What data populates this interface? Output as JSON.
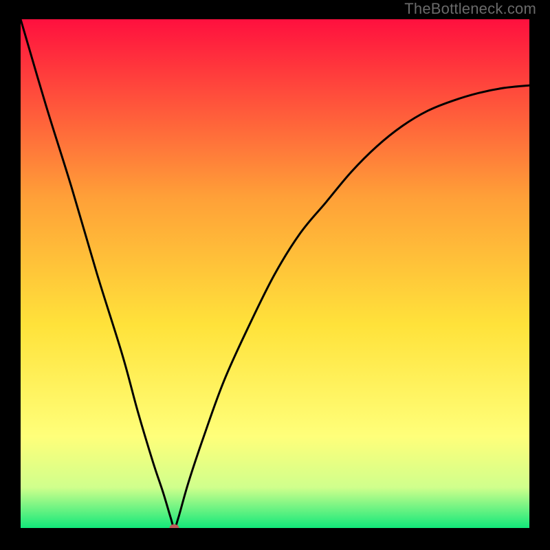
{
  "watermark": "TheBottleneck.com",
  "colors": {
    "frame": "#000000",
    "gradient_top": "#ff103e",
    "gradient_mid_upper": "#ffa038",
    "gradient_mid": "#ffe23a",
    "gradient_low": "#ffff7a",
    "gradient_near_bottom": "#d0ff8c",
    "gradient_bottom": "#12e87a",
    "curve": "#000000",
    "marker": "#bf5b5b"
  },
  "chart_data": {
    "type": "line",
    "title": "",
    "xlabel": "",
    "ylabel": "",
    "xlim": [
      0,
      1
    ],
    "ylim": [
      0,
      1
    ],
    "marker": {
      "x": 0.302,
      "y": 0.0
    },
    "series": [
      {
        "name": "curve",
        "x": [
          0.0,
          0.05,
          0.1,
          0.15,
          0.2,
          0.23,
          0.26,
          0.28,
          0.295,
          0.302,
          0.31,
          0.33,
          0.36,
          0.4,
          0.45,
          0.5,
          0.55,
          0.6,
          0.65,
          0.7,
          0.75,
          0.8,
          0.85,
          0.9,
          0.95,
          1.0
        ],
        "y": [
          1.0,
          0.83,
          0.67,
          0.5,
          0.34,
          0.23,
          0.13,
          0.07,
          0.02,
          0.0,
          0.02,
          0.09,
          0.18,
          0.29,
          0.4,
          0.5,
          0.58,
          0.64,
          0.7,
          0.75,
          0.79,
          0.82,
          0.84,
          0.855,
          0.865,
          0.87
        ]
      }
    ]
  }
}
